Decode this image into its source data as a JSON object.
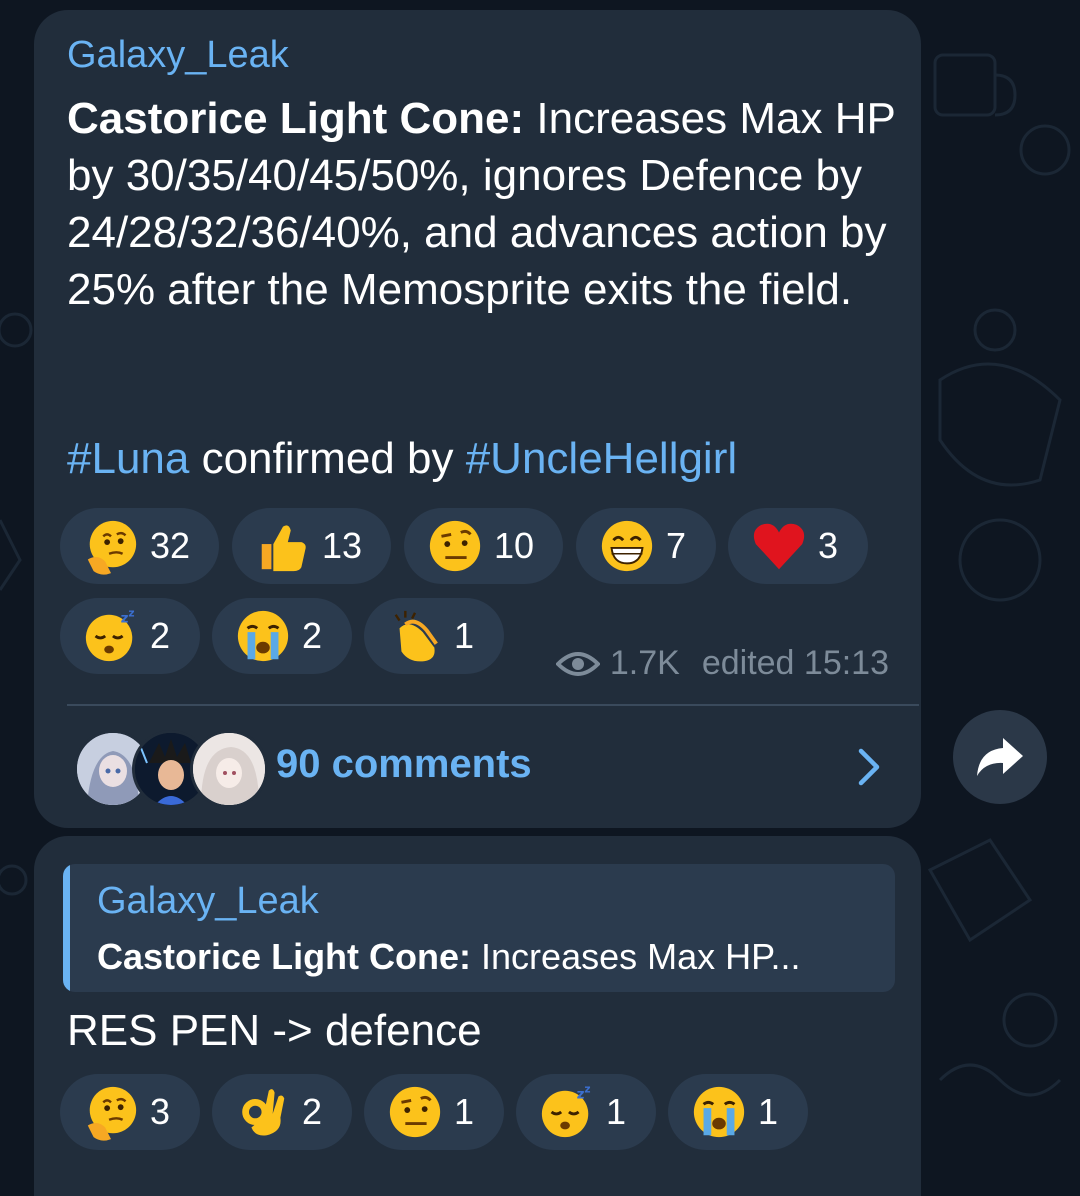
{
  "post": {
    "author": "Galaxy_Leak",
    "text_bold": "Castorice Light Cone:",
    "text_body": " Increases Max HP by 30/35/40/45/50%, ignores Defence by 24/28/32/36/40%, and advances action by 25% after the Memosprite exits the field.",
    "tag1": "#Luna",
    "tag_mid": " confirmed by ",
    "tag2": "#UncleHellgirl",
    "reactions": [
      {
        "emoji": "thinking-face",
        "count": "32"
      },
      {
        "emoji": "thumbs-up",
        "count": "13"
      },
      {
        "emoji": "raised-eyebrow-face",
        "count": "10"
      },
      {
        "emoji": "grinning-face",
        "count": "7"
      },
      {
        "emoji": "red-heart",
        "count": "3"
      },
      {
        "emoji": "sleeping-face",
        "count": "2"
      },
      {
        "emoji": "crying-face",
        "count": "2"
      },
      {
        "emoji": "clapping-hands",
        "count": "1"
      }
    ],
    "views": "1.7K",
    "edited": "edited 15:13",
    "comments_label": "90 comments"
  },
  "reply": {
    "quote_author": "Galaxy_Leak",
    "quote_bold": "Castorice Light Cone:",
    "quote_text": " Increases Max HP...",
    "text": "RES PEN -> defence",
    "reactions": [
      {
        "emoji": "thinking-face",
        "count": "3"
      },
      {
        "emoji": "ok-hand",
        "count": "2"
      },
      {
        "emoji": "raised-eyebrow-face",
        "count": "1"
      },
      {
        "emoji": "sleeping-face",
        "count": "1"
      },
      {
        "emoji": "crying-face",
        "count": "1"
      }
    ]
  },
  "colors": {
    "background": "#0e1621",
    "bubble": "#212d3b",
    "reaction_pill": "#2b3b4e",
    "link": "#6ab3f3",
    "meta": "#7d8b99"
  }
}
